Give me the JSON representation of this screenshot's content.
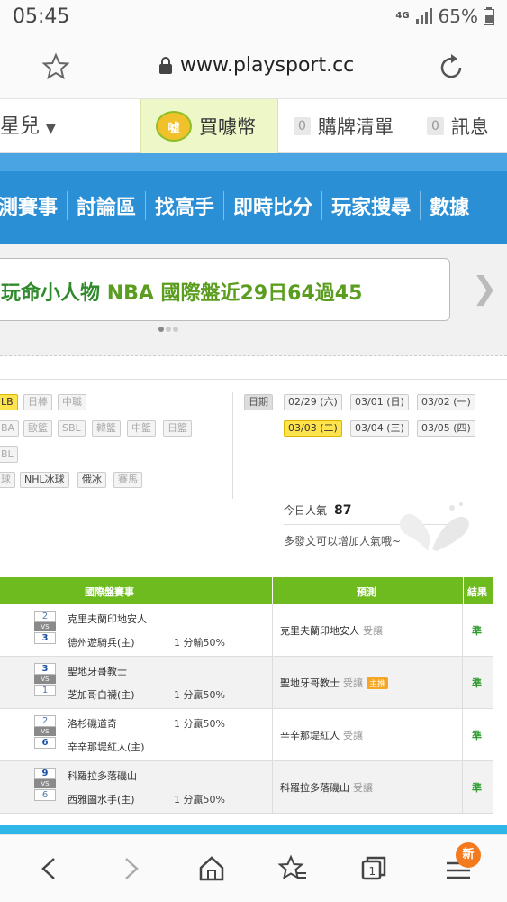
{
  "status_bar": {
    "time": "05:45",
    "network": "4G",
    "battery": "65%"
  },
  "browser": {
    "url": "www.playsport.cc"
  },
  "top_bar": {
    "user": "星兒",
    "coin_icon": "嘘",
    "coin_label": "買噱幣",
    "cart_count": "0",
    "cart_label": "購牌清單",
    "msg_count": "0",
    "msg_label": "訊息"
  },
  "nav": {
    "items": [
      "測賽事",
      "討論區",
      "找高手",
      "即時比分",
      "玩家搜尋",
      "數據"
    ]
  },
  "banner": {
    "part1": "玩命小人物",
    "part2": "NBA 國際盤近29日64過45"
  },
  "leagues": {
    "row1": [
      "LB",
      "日棒",
      "中職"
    ],
    "row2": [
      "BA",
      "歐籃",
      "SBL",
      "韓籃",
      "中籃",
      "日籃"
    ],
    "row3": [
      "BL"
    ],
    "row4": [
      "球",
      "NHL冰球",
      "俄冰",
      "賽馬"
    ]
  },
  "dates": {
    "label": "日期",
    "row1": [
      "02/29 (六)",
      "03/01 (日)",
      "03/02 (一)"
    ],
    "row2": [
      "03/03 (二)",
      "03/04 (三)",
      "03/05 (四)"
    ],
    "selected": "03/03 (二)"
  },
  "popularity": {
    "label": "今日人氣",
    "value": "87",
    "hint": "多發文可以增加人氣哦~"
  },
  "table": {
    "headers": {
      "event": "國際盤賽事",
      "pred": "預測",
      "result": "結果"
    },
    "vs": "VS",
    "rows": [
      {
        "s1": "2",
        "t1": "克里夫蘭印地安人",
        "o1": "",
        "s2": "3",
        "t2": "德州遊騎兵(主)",
        "o2": "1 分輸50%",
        "pick": "克里夫蘭印地安人",
        "give": "受讓",
        "main": "",
        "result": "準"
      },
      {
        "s1": "3",
        "t1": "聖地牙哥教士",
        "o1": "",
        "s2": "1",
        "t2": "芝加哥白襪(主)",
        "o2": "1 分贏50%",
        "pick": "聖地牙哥教士",
        "give": "受讓",
        "main": "主推",
        "result": "準"
      },
      {
        "s1": "2",
        "t1": "洛杉磯道奇",
        "o1": "1 分贏50%",
        "s2": "6",
        "t2": "辛辛那堤紅人(主)",
        "o2": "",
        "pick": "辛辛那堤紅人",
        "give": "受讓",
        "main": "",
        "result": "準"
      },
      {
        "s1": "9",
        "t1": "科羅拉多落磯山",
        "o1": "",
        "s2": "6",
        "t2": "西雅圖水手(主)",
        "o2": "1 分贏50%",
        "pick": "科羅拉多落磯山",
        "give": "受讓",
        "main": "",
        "result": "準"
      }
    ]
  },
  "bottom_nav": {
    "new_badge": "新"
  }
}
